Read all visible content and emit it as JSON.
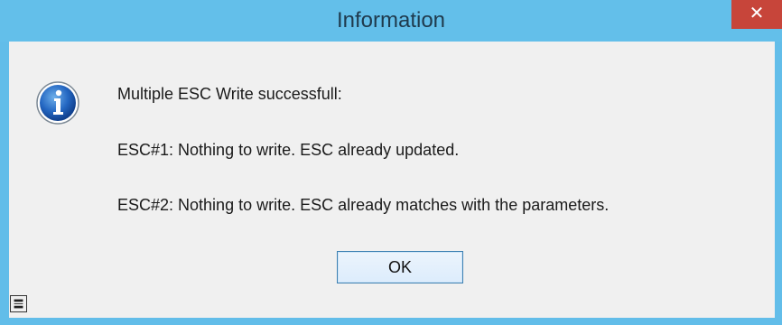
{
  "window": {
    "title": "Information",
    "close_glyph": "✕"
  },
  "message": {
    "line1": "Multiple ESC Write successfull:",
    "line2": "ESC#1: Nothing to write. ESC already updated.",
    "line3": "ESC#2: Nothing to write. ESC already matches with the parameters."
  },
  "buttons": {
    "ok_label": "OK"
  },
  "icons": {
    "main": "information-icon",
    "status": "window-state-icon"
  },
  "colors": {
    "titlebar": "#63bfea",
    "close": "#c7453a",
    "body": "#f0f0f0"
  }
}
